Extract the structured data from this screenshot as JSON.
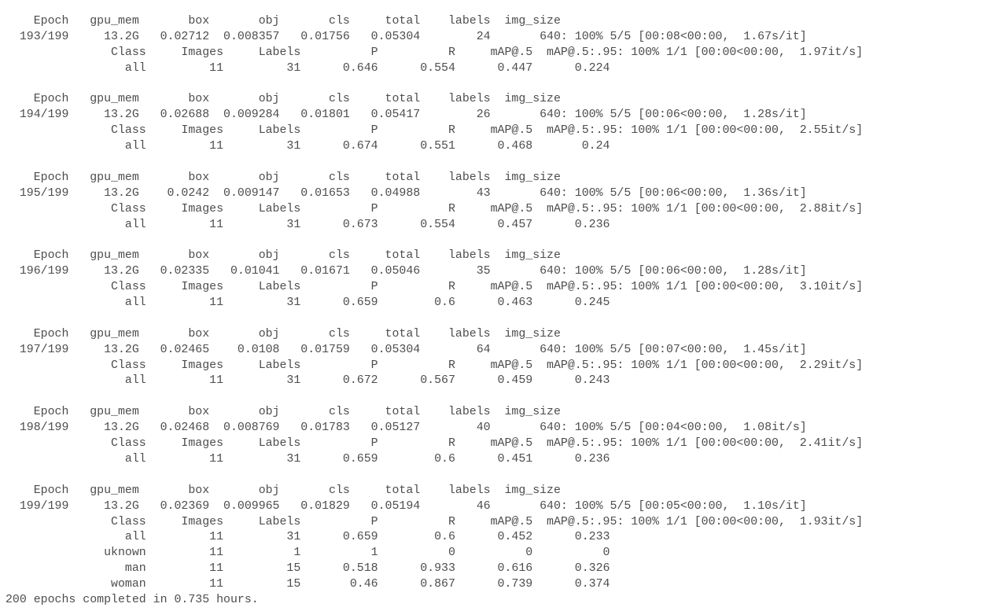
{
  "terminal": {
    "lines": [
      "    Epoch   gpu_mem       box       obj       cls     total    labels  img_size",
      "  193/199     13.2G   0.02712  0.008357   0.01756   0.05304        24       640: 100% 5/5 [00:08<00:00,  1.67s/it]",
      "               Class     Images     Labels          P          R     mAP@.5  mAP@.5:.95: 100% 1/1 [00:00<00:00,  1.97it/s]",
      "                 all         11         31      0.646      0.554      0.447      0.224",
      "",
      "    Epoch   gpu_mem       box       obj       cls     total    labels  img_size",
      "  194/199     13.2G   0.02688  0.009284   0.01801   0.05417        26       640: 100% 5/5 [00:06<00:00,  1.28s/it]",
      "               Class     Images     Labels          P          R     mAP@.5  mAP@.5:.95: 100% 1/1 [00:00<00:00,  2.55it/s]",
      "                 all         11         31      0.674      0.551      0.468       0.24",
      "",
      "    Epoch   gpu_mem       box       obj       cls     total    labels  img_size",
      "  195/199     13.2G    0.0242  0.009147   0.01653   0.04988        43       640: 100% 5/5 [00:06<00:00,  1.36s/it]",
      "               Class     Images     Labels          P          R     mAP@.5  mAP@.5:.95: 100% 1/1 [00:00<00:00,  2.88it/s]",
      "                 all         11         31      0.673      0.554      0.457      0.236",
      "",
      "    Epoch   gpu_mem       box       obj       cls     total    labels  img_size",
      "  196/199     13.2G   0.02335   0.01041   0.01671   0.05046        35       640: 100% 5/5 [00:06<00:00,  1.28s/it]",
      "               Class     Images     Labels          P          R     mAP@.5  mAP@.5:.95: 100% 1/1 [00:00<00:00,  3.10it/s]",
      "                 all         11         31      0.659        0.6      0.463      0.245",
      "",
      "    Epoch   gpu_mem       box       obj       cls     total    labels  img_size",
      "  197/199     13.2G   0.02465    0.0108   0.01759   0.05304        64       640: 100% 5/5 [00:07<00:00,  1.45s/it]",
      "               Class     Images     Labels          P          R     mAP@.5  mAP@.5:.95: 100% 1/1 [00:00<00:00,  2.29it/s]",
      "                 all         11         31      0.672      0.567      0.459      0.243",
      "",
      "    Epoch   gpu_mem       box       obj       cls     total    labels  img_size",
      "  198/199     13.2G   0.02468  0.008769   0.01783   0.05127        40       640: 100% 5/5 [00:04<00:00,  1.08it/s]",
      "               Class     Images     Labels          P          R     mAP@.5  mAP@.5:.95: 100% 1/1 [00:00<00:00,  2.41it/s]",
      "                 all         11         31      0.659        0.6      0.451      0.236",
      "",
      "    Epoch   gpu_mem       box       obj       cls     total    labels  img_size",
      "  199/199     13.2G   0.02369  0.009965   0.01829   0.05194        46       640: 100% 5/5 [00:05<00:00,  1.10s/it]",
      "               Class     Images     Labels          P          R     mAP@.5  mAP@.5:.95: 100% 1/1 [00:00<00:00,  1.93it/s]",
      "                 all         11         31      0.659        0.6      0.452      0.233",
      "              uknown         11          1          1          0          0          0",
      "                 man         11         15      0.518      0.933      0.616      0.326",
      "               woman         11         15       0.46      0.867      0.739      0.374",
      "200 epochs completed in 0.735 hours."
    ]
  }
}
